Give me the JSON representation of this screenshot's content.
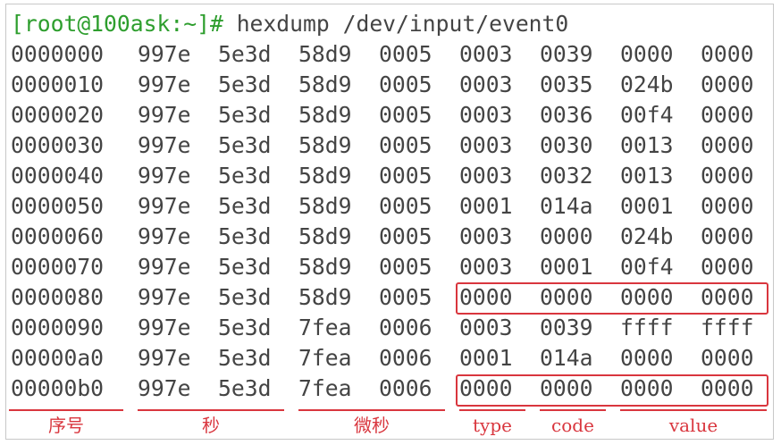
{
  "terminal": {
    "prompt": "[root@100ask:~]#",
    "command": "hexdump /dev/input/event0",
    "rows": [
      [
        "0000000",
        "997e",
        "5e3d",
        "58d9",
        "0005",
        "0003",
        "0039",
        "0000",
        "0000"
      ],
      [
        "0000010",
        "997e",
        "5e3d",
        "58d9",
        "0005",
        "0003",
        "0035",
        "024b",
        "0000"
      ],
      [
        "0000020",
        "997e",
        "5e3d",
        "58d9",
        "0005",
        "0003",
        "0036",
        "00f4",
        "0000"
      ],
      [
        "0000030",
        "997e",
        "5e3d",
        "58d9",
        "0005",
        "0003",
        "0030",
        "0013",
        "0000"
      ],
      [
        "0000040",
        "997e",
        "5e3d",
        "58d9",
        "0005",
        "0003",
        "0032",
        "0013",
        "0000"
      ],
      [
        "0000050",
        "997e",
        "5e3d",
        "58d9",
        "0005",
        "0001",
        "014a",
        "0001",
        "0000"
      ],
      [
        "0000060",
        "997e",
        "5e3d",
        "58d9",
        "0005",
        "0003",
        "0000",
        "024b",
        "0000"
      ],
      [
        "0000070",
        "997e",
        "5e3d",
        "58d9",
        "0005",
        "0003",
        "0001",
        "00f4",
        "0000"
      ],
      [
        "0000080",
        "997e",
        "5e3d",
        "58d9",
        "0005",
        "0000",
        "0000",
        "0000",
        "0000"
      ],
      [
        "0000090",
        "997e",
        "5e3d",
        "7fea",
        "0006",
        "0003",
        "0039",
        "ffff",
        "ffff"
      ],
      [
        "00000a0",
        "997e",
        "5e3d",
        "7fea",
        "0006",
        "0001",
        "014a",
        "0000",
        "0000"
      ],
      [
        "00000b0",
        "997e",
        "5e3d",
        "7fea",
        "0006",
        "0000",
        "0000",
        "0000",
        "0000"
      ]
    ]
  },
  "annotations": {
    "labels": {
      "seq": "序号",
      "sec": "秒",
      "usec": "微秒",
      "type": "type",
      "code": "code",
      "value": "value"
    },
    "highlight_color": "#d9363e"
  }
}
